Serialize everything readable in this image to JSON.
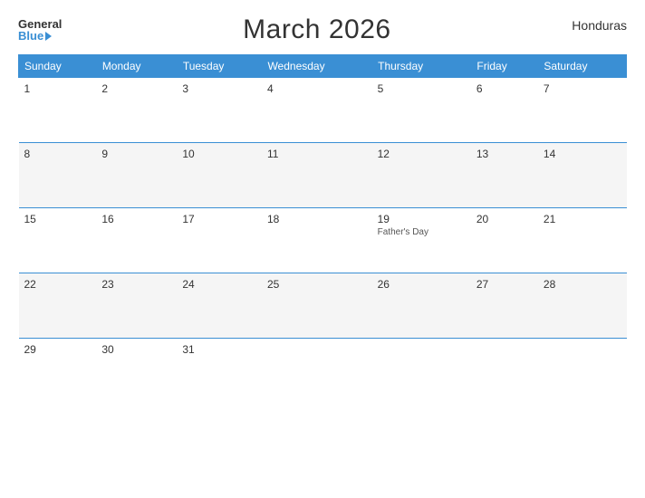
{
  "header": {
    "logo_general": "General",
    "logo_blue": "Blue",
    "title": "March 2026",
    "country": "Honduras"
  },
  "calendar": {
    "days_of_week": [
      "Sunday",
      "Monday",
      "Tuesday",
      "Wednesday",
      "Thursday",
      "Friday",
      "Saturday"
    ],
    "weeks": [
      [
        {
          "day": "1",
          "event": ""
        },
        {
          "day": "2",
          "event": ""
        },
        {
          "day": "3",
          "event": ""
        },
        {
          "day": "4",
          "event": ""
        },
        {
          "day": "5",
          "event": ""
        },
        {
          "day": "6",
          "event": ""
        },
        {
          "day": "7",
          "event": ""
        }
      ],
      [
        {
          "day": "8",
          "event": ""
        },
        {
          "day": "9",
          "event": ""
        },
        {
          "day": "10",
          "event": ""
        },
        {
          "day": "11",
          "event": ""
        },
        {
          "day": "12",
          "event": ""
        },
        {
          "day": "13",
          "event": ""
        },
        {
          "day": "14",
          "event": ""
        }
      ],
      [
        {
          "day": "15",
          "event": ""
        },
        {
          "day": "16",
          "event": ""
        },
        {
          "day": "17",
          "event": ""
        },
        {
          "day": "18",
          "event": ""
        },
        {
          "day": "19",
          "event": "Father's Day"
        },
        {
          "day": "20",
          "event": ""
        },
        {
          "day": "21",
          "event": ""
        }
      ],
      [
        {
          "day": "22",
          "event": ""
        },
        {
          "day": "23",
          "event": ""
        },
        {
          "day": "24",
          "event": ""
        },
        {
          "day": "25",
          "event": ""
        },
        {
          "day": "26",
          "event": ""
        },
        {
          "day": "27",
          "event": ""
        },
        {
          "day": "28",
          "event": ""
        }
      ],
      [
        {
          "day": "29",
          "event": ""
        },
        {
          "day": "30",
          "event": ""
        },
        {
          "day": "31",
          "event": ""
        },
        {
          "day": "",
          "event": ""
        },
        {
          "day": "",
          "event": ""
        },
        {
          "day": "",
          "event": ""
        },
        {
          "day": "",
          "event": ""
        }
      ]
    ]
  }
}
